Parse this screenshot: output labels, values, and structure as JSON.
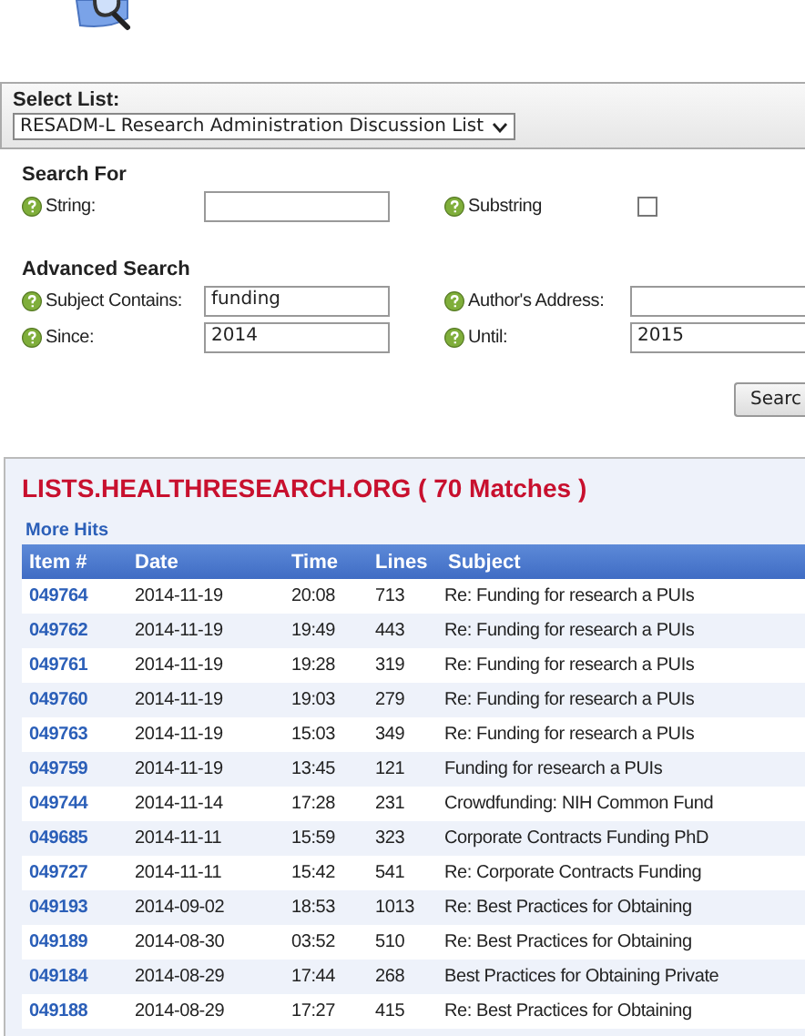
{
  "select_list": {
    "label": "Select List:",
    "value": "RESADM-L Research Administration Discussion List"
  },
  "search_for": {
    "heading": "Search For",
    "fields": [
      {
        "kind": "text",
        "label": "String:"
      },
      {
        "kind": "checkbox",
        "label": "Substring",
        "checked": false
      }
    ]
  },
  "advanced_search": {
    "heading": "Advanced Search",
    "fields": [
      {
        "kind": "text",
        "label": "Subject Contains:",
        "value": "funding"
      },
      {
        "kind": "text",
        "label": "Author's Address:"
      },
      {
        "kind": "text",
        "label": "Since:",
        "value": "2014"
      },
      {
        "kind": "text",
        "label": "Until:",
        "value": "2015"
      }
    ]
  },
  "search_button": "Searc",
  "results": {
    "title": "LISTS.HEALTHRESEARCH.ORG ( 70 Matches )",
    "more_hits": "More Hits",
    "columns": [
      "Item #",
      "Date",
      "Time",
      "Lines",
      "Subject"
    ],
    "rows": [
      {
        "item": "049764",
        "date": "2014-11-19",
        "time": "20:08",
        "lines": "713",
        "subject": "Re: Funding for research a PUIs"
      },
      {
        "item": "049762",
        "date": "2014-11-19",
        "time": "19:49",
        "lines": "443",
        "subject": "Re: Funding for research a PUIs"
      },
      {
        "item": "049761",
        "date": "2014-11-19",
        "time": "19:28",
        "lines": "319",
        "subject": "Re: Funding for research a PUIs"
      },
      {
        "item": "049760",
        "date": "2014-11-19",
        "time": "19:03",
        "lines": "279",
        "subject": "Re: Funding for research a PUIs"
      },
      {
        "item": "049763",
        "date": "2014-11-19",
        "time": "15:03",
        "lines": "349",
        "subject": "Re: Funding for research a PUIs"
      },
      {
        "item": "049759",
        "date": "2014-11-19",
        "time": "13:45",
        "lines": "121",
        "subject": "Funding for research a PUIs"
      },
      {
        "item": "049744",
        "date": "2014-11-14",
        "time": "17:28",
        "lines": "231",
        "subject": "Crowdfunding: NIH Common Fund"
      },
      {
        "item": "049685",
        "date": "2014-11-11",
        "time": "15:59",
        "lines": "323",
        "subject": "Corporate Contracts Funding PhD"
      },
      {
        "item": "049727",
        "date": "2014-11-11",
        "time": "15:42",
        "lines": "541",
        "subject": "Re: Corporate Contracts Funding"
      },
      {
        "item": "049193",
        "date": "2014-09-02",
        "time": "18:53",
        "lines": "1013",
        "subject": "Re: Best Practices for Obtaining"
      },
      {
        "item": "049189",
        "date": "2014-08-30",
        "time": "03:52",
        "lines": "510",
        "subject": "Re: Best Practices for Obtaining"
      },
      {
        "item": "049184",
        "date": "2014-08-29",
        "time": "17:44",
        "lines": "268",
        "subject": "Best Practices for Obtaining Private"
      },
      {
        "item": "049188",
        "date": "2014-08-29",
        "time": "17:27",
        "lines": "415",
        "subject": "Re: Best Practices for Obtaining"
      }
    ]
  }
}
